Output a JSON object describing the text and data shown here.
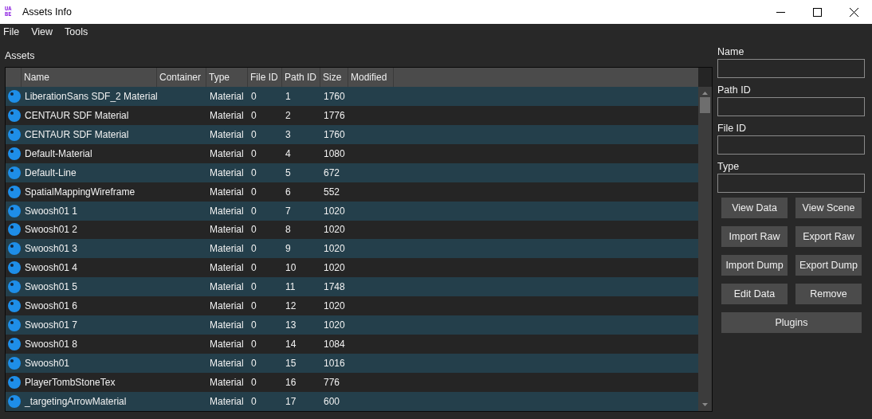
{
  "window": {
    "logo": [
      "UA",
      "BE"
    ],
    "title": "Assets Info"
  },
  "menu": [
    "File",
    "View",
    "Tools"
  ],
  "assets_label": "Assets",
  "table": {
    "columns": [
      "Name",
      "Container",
      "Type",
      "File ID",
      "Path ID",
      "Size",
      "Modified"
    ],
    "rows": [
      {
        "name": "LiberationSans SDF_2 Material",
        "container": "",
        "type": "Material",
        "file_id": "0",
        "path_id": "1",
        "size": "1760"
      },
      {
        "name": "CENTAUR SDF Material",
        "type": "Material",
        "file_id": "0",
        "path_id": "2",
        "size": "1776"
      },
      {
        "name": "CENTAUR SDF Material",
        "type": "Material",
        "file_id": "0",
        "path_id": "3",
        "size": "1760"
      },
      {
        "name": "Default-Material",
        "type": "Material",
        "file_id": "0",
        "path_id": "4",
        "size": "1080"
      },
      {
        "name": "Default-Line",
        "type": "Material",
        "file_id": "0",
        "path_id": "5",
        "size": "672"
      },
      {
        "name": "SpatialMappingWireframe",
        "type": "Material",
        "file_id": "0",
        "path_id": "6",
        "size": "552"
      },
      {
        "name": "Swoosh01 1",
        "type": "Material",
        "file_id": "0",
        "path_id": "7",
        "size": "1020"
      },
      {
        "name": "Swoosh01 2",
        "type": "Material",
        "file_id": "0",
        "path_id": "8",
        "size": "1020"
      },
      {
        "name": "Swoosh01 3",
        "type": "Material",
        "file_id": "0",
        "path_id": "9",
        "size": "1020"
      },
      {
        "name": "Swoosh01 4",
        "type": "Material",
        "file_id": "0",
        "path_id": "10",
        "size": "1020"
      },
      {
        "name": "Swoosh01 5",
        "type": "Material",
        "file_id": "0",
        "path_id": "11",
        "size": "1748"
      },
      {
        "name": "Swoosh01 6",
        "type": "Material",
        "file_id": "0",
        "path_id": "12",
        "size": "1020"
      },
      {
        "name": "Swoosh01 7",
        "type": "Material",
        "file_id": "0",
        "path_id": "13",
        "size": "1020"
      },
      {
        "name": "Swoosh01 8",
        "type": "Material",
        "file_id": "0",
        "path_id": "14",
        "size": "1084"
      },
      {
        "name": "Swoosh01",
        "type": "Material",
        "file_id": "0",
        "path_id": "15",
        "size": "1016"
      },
      {
        "name": "PlayerTombStoneTex",
        "type": "Material",
        "file_id": "0",
        "path_id": "16",
        "size": "776"
      },
      {
        "name": "_targetingArrowMaterial",
        "type": "Material",
        "file_id": "0",
        "path_id": "17",
        "size": "600"
      }
    ]
  },
  "fields": [
    "Name",
    "Path ID",
    "File ID",
    "Type"
  ],
  "buttons": [
    "View Data",
    "View Scene",
    "Import Raw",
    "Export Raw",
    "Import Dump",
    "Export Dump",
    "Edit Data",
    "Remove"
  ],
  "wide_button": "Plugins"
}
